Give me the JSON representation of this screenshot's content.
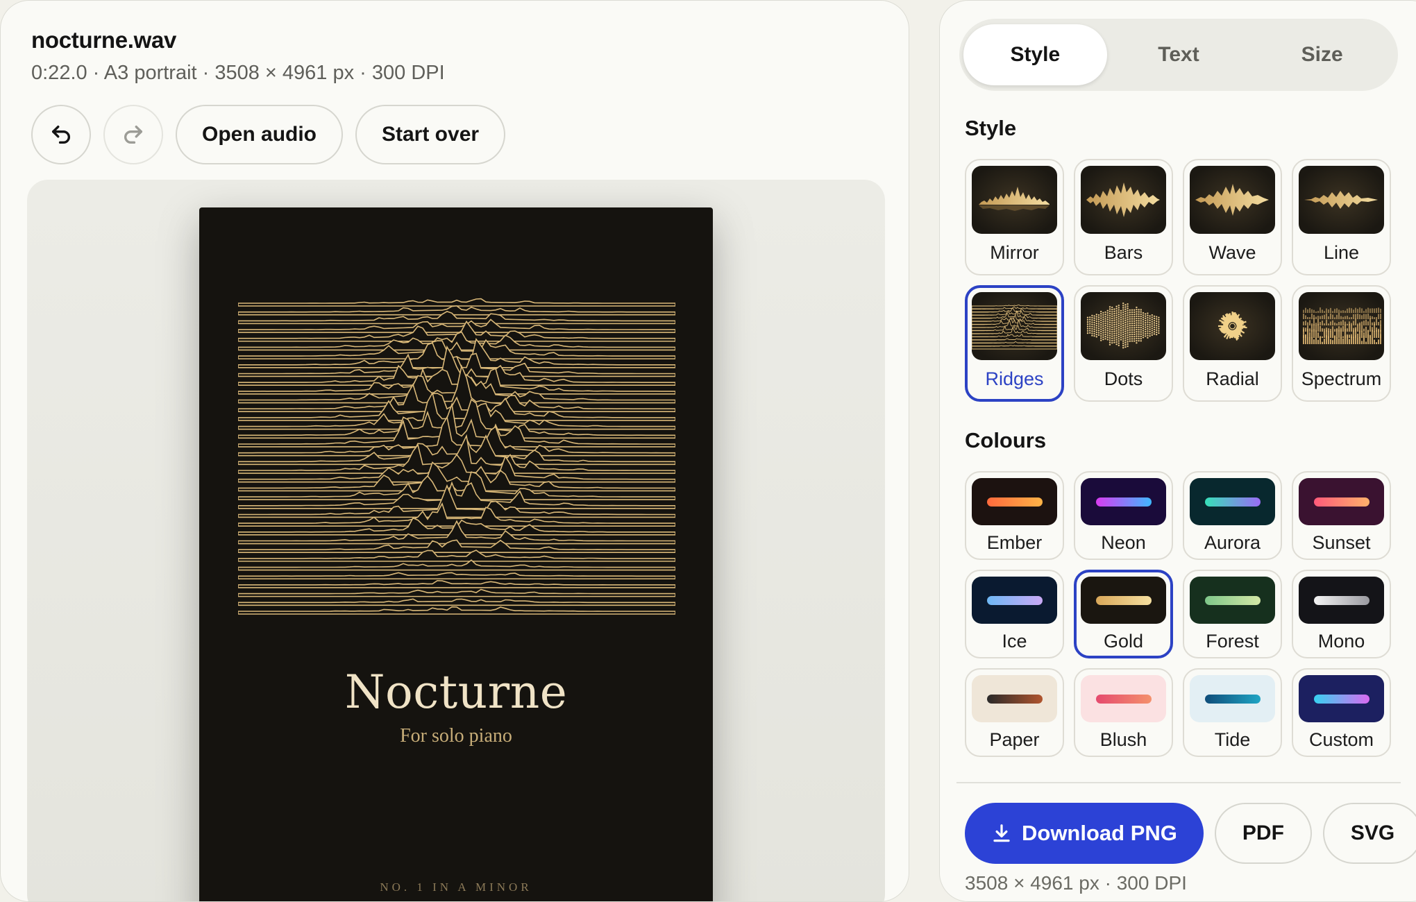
{
  "file": {
    "name": "nocturne.wav",
    "meta": "0:22.0 · A3 portrait · 3508 × 4961 px · 300 DPI"
  },
  "toolbar": {
    "undo_icon": "undo-icon",
    "redo_icon": "redo-icon",
    "open_audio_label": "Open audio",
    "start_over_label": "Start over"
  },
  "poster": {
    "title": "Nocturne",
    "subtitle": "For solo piano",
    "footer": "NO. 1 IN A MINOR"
  },
  "tabs": [
    {
      "label": "Style",
      "active": true
    },
    {
      "label": "Text",
      "active": false
    },
    {
      "label": "Size",
      "active": false
    }
  ],
  "style_section": {
    "heading": "Style",
    "items": [
      {
        "label": "Mirror",
        "selected": false
      },
      {
        "label": "Bars",
        "selected": false
      },
      {
        "label": "Wave",
        "selected": false
      },
      {
        "label": "Line",
        "selected": false
      },
      {
        "label": "Ridges",
        "selected": true
      },
      {
        "label": "Dots",
        "selected": false
      },
      {
        "label": "Radial",
        "selected": false
      },
      {
        "label": "Spectrum",
        "selected": false
      }
    ]
  },
  "colours_section": {
    "heading": "Colours",
    "items": [
      {
        "label": "Ember",
        "bg": "#1c1210",
        "from": "#ff6a3d",
        "to": "#ffb347",
        "selected": false
      },
      {
        "label": "Neon",
        "bg": "#1a0b3a",
        "from": "#d93cf0",
        "to": "#3fb8ff",
        "selected": false
      },
      {
        "label": "Aurora",
        "bg": "#08282e",
        "from": "#37e0b8",
        "to": "#9a6cf5",
        "selected": false
      },
      {
        "label": "Sunset",
        "bg": "#3a1230",
        "from": "#ff5a7a",
        "to": "#ffb26b",
        "selected": false
      },
      {
        "label": "Ice",
        "bg": "#0a1a30",
        "from": "#6fb8f5",
        "to": "#c9a9f5",
        "selected": false
      },
      {
        "label": "Gold",
        "bg": "#1a1610",
        "from": "#d9a85a",
        "to": "#f5dfa0",
        "selected": true
      },
      {
        "label": "Forest",
        "bg": "#16301e",
        "from": "#7fc78a",
        "to": "#d4e8a6",
        "selected": false
      },
      {
        "label": "Mono",
        "bg": "#141418",
        "from": "#f4f4f4",
        "to": "#9a9aa0",
        "selected": false
      },
      {
        "label": "Paper",
        "bg": "#efe6d8",
        "from": "#2a2a2a",
        "to": "#b0552e",
        "selected": false
      },
      {
        "label": "Blush",
        "bg": "#fbe1e2",
        "from": "#e54a6e",
        "to": "#f4916c",
        "selected": false
      },
      {
        "label": "Tide",
        "bg": "#e3eff4",
        "from": "#0f4d7a",
        "to": "#1fa5c4",
        "selected": false
      },
      {
        "label": "Custom",
        "bg": "#1c2060",
        "from": "#37d1f0",
        "to": "#d96af0",
        "selected": false
      }
    ]
  },
  "export": {
    "download_label": "Download PNG",
    "download_icon": "download-icon",
    "pdf_label": "PDF",
    "svg_label": "SVG",
    "meta": "3508 × 4961 px · 300 DPI"
  },
  "colors": {
    "accent": "#2c42d6",
    "poster_bg": "#15130f",
    "ridge_line": "#d9b878"
  }
}
